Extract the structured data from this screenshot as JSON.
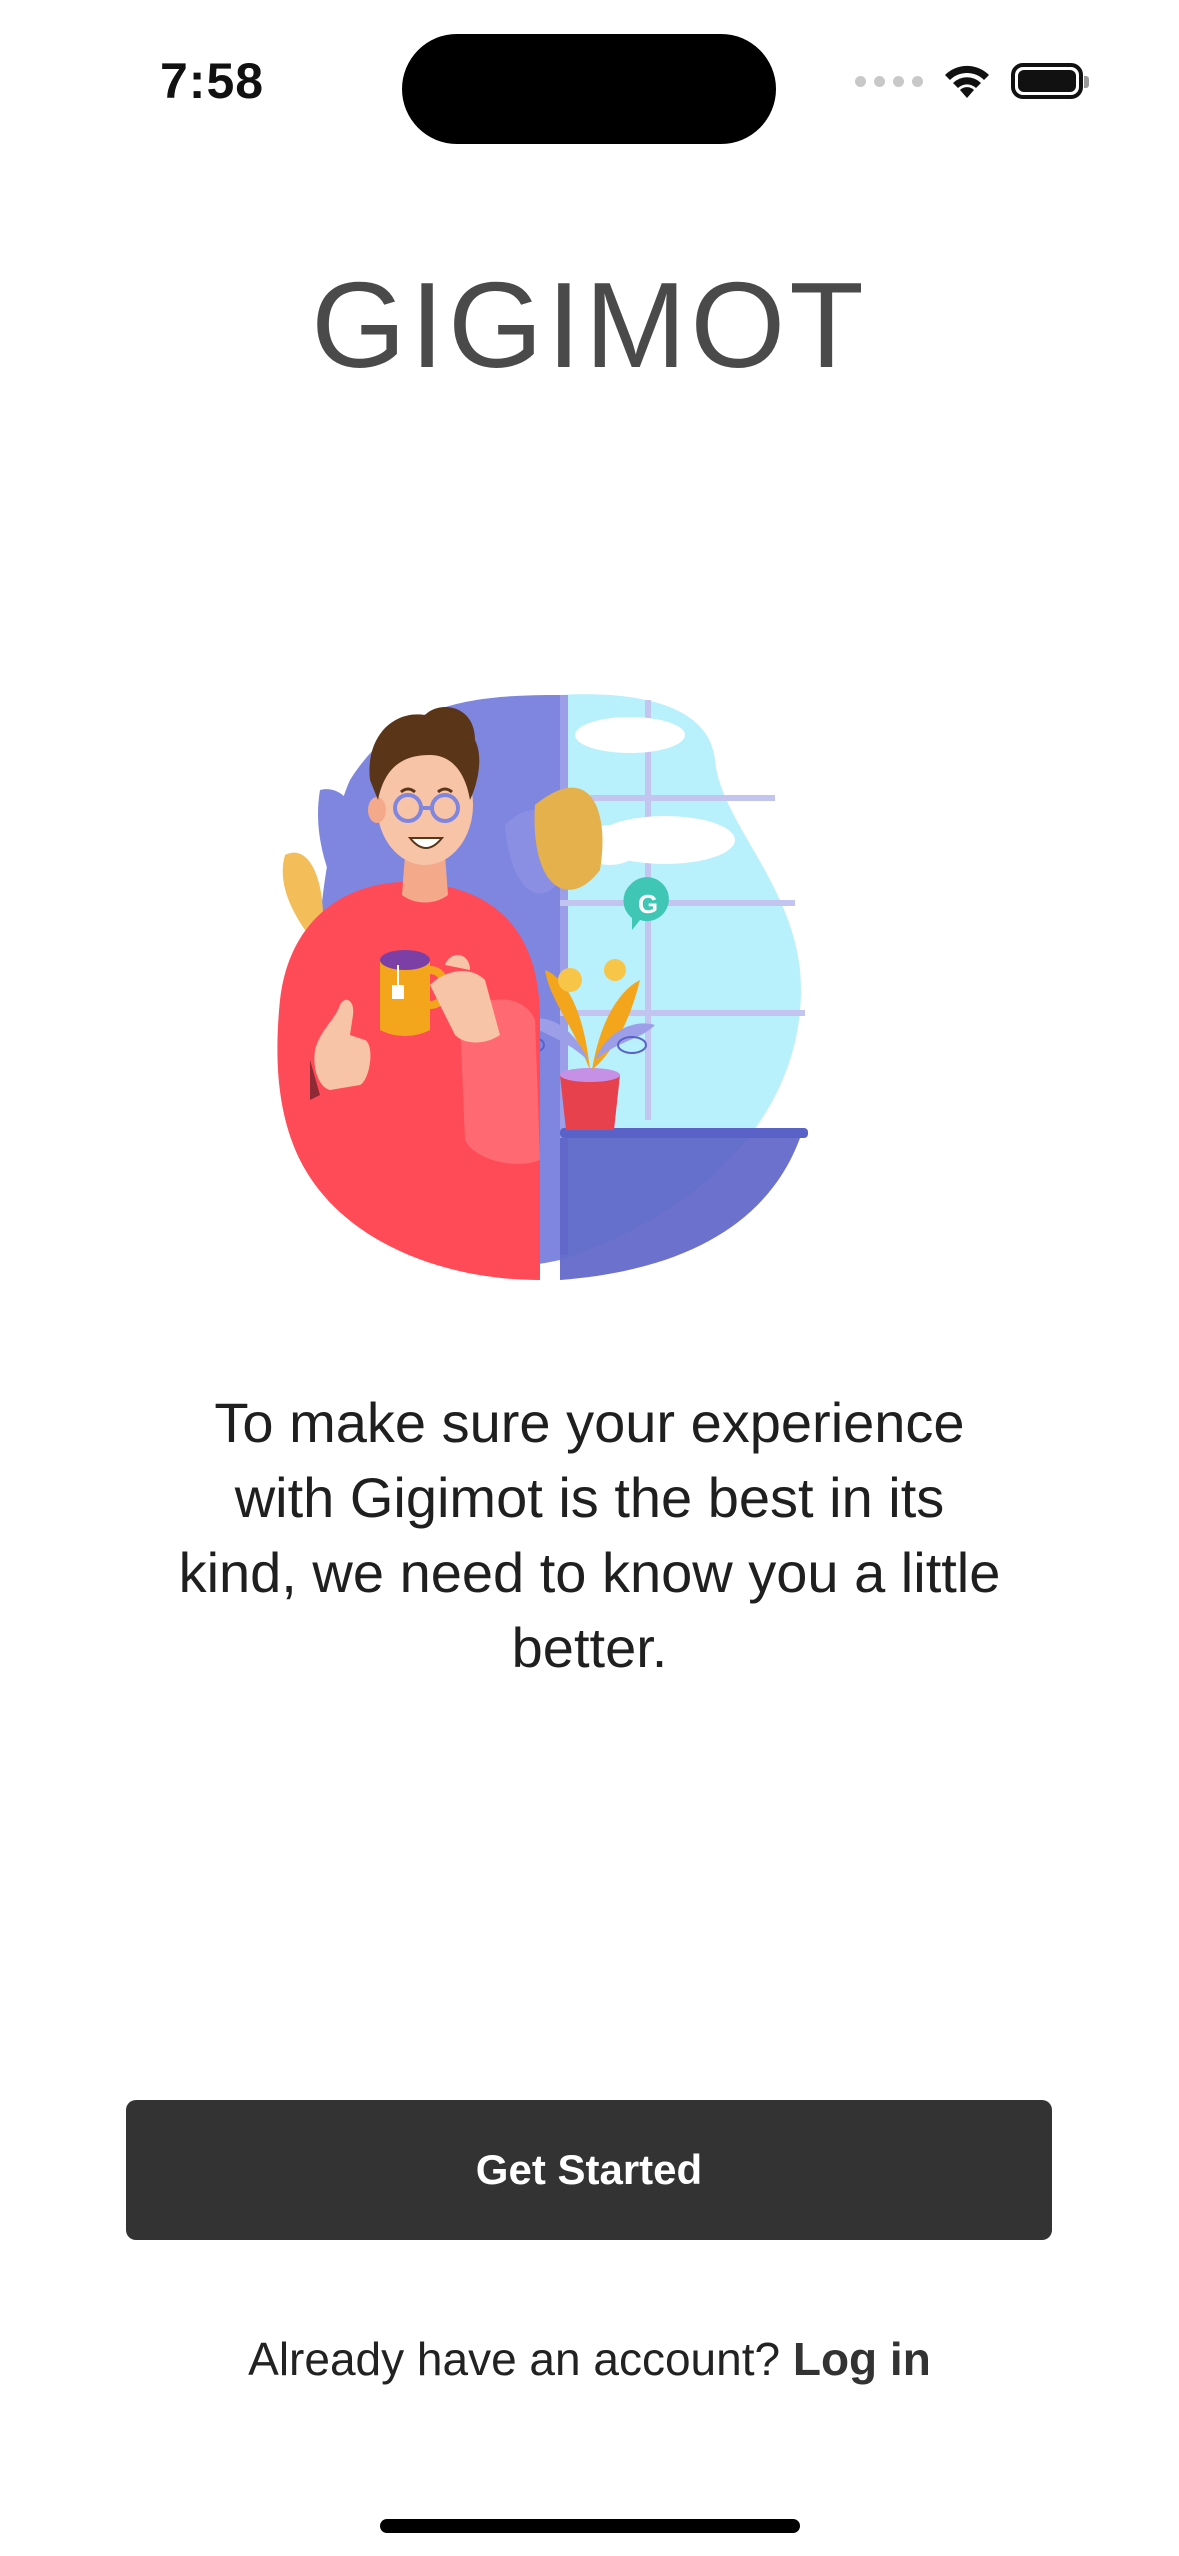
{
  "status_bar": {
    "time": "7:58"
  },
  "app": {
    "logo": "GIGIMOT"
  },
  "illustration": {
    "badge_letter": "G"
  },
  "intro": {
    "text": "To make sure your experience with Gigimot is the best in its kind, we need to know you a little better."
  },
  "actions": {
    "get_started": "Get Started"
  },
  "login": {
    "prompt": "Already have an account?",
    "link": "Log in"
  },
  "colors": {
    "button_bg": "#333333",
    "logo": "#4a4a4a",
    "sweater": "#ff4b57",
    "sky": "#b8f0fb",
    "blob_purple": "#7f86e0",
    "pot": "#e8414e",
    "leaf_orange": "#f3a51b"
  }
}
